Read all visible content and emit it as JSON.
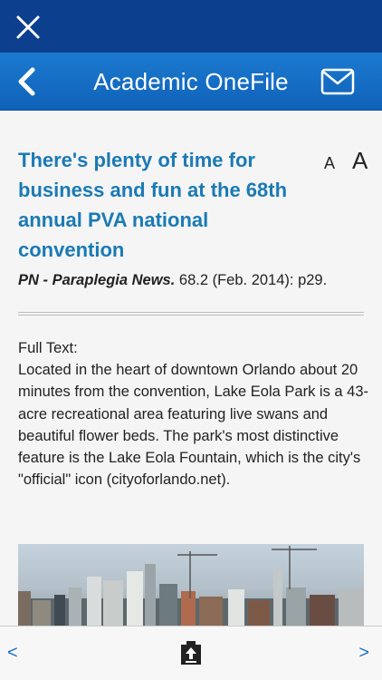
{
  "window": {
    "close_icon": "close-icon"
  },
  "nav": {
    "title": "Academic OneFile",
    "back_icon": "chevron-left-icon",
    "mail_icon": "mail-icon"
  },
  "article": {
    "headline": "There's plenty of time for business and fun at the 68th annual PVA national convention",
    "font_small_label": "A",
    "font_large_label": "A",
    "citation_source": "PN - Paraplegia News.",
    "citation_details": " 68.2 (Feb. 2014): p29.",
    "full_text_label": "Full Text:",
    "body": "Located in the heart of downtown Orlando about 20 minutes from the convention, Lake Eola Park is a 43-acre recreational area featuring live swans and beautiful flower beds. The park's most distinctive feature is the Lake Eola Fountain, which is the city's \"official\" icon (cityoforlando.net).",
    "image": "city-skyline-photo"
  },
  "toolbar": {
    "prev_label": "<",
    "next_label": ">",
    "center_icon": "clipboard-upload-icon"
  },
  "colors": {
    "top_bar": "#0d3f8f",
    "nav_bar": "#1570c8",
    "headline": "#1a7ab5",
    "toolbar_accent": "#1d6fc9"
  }
}
